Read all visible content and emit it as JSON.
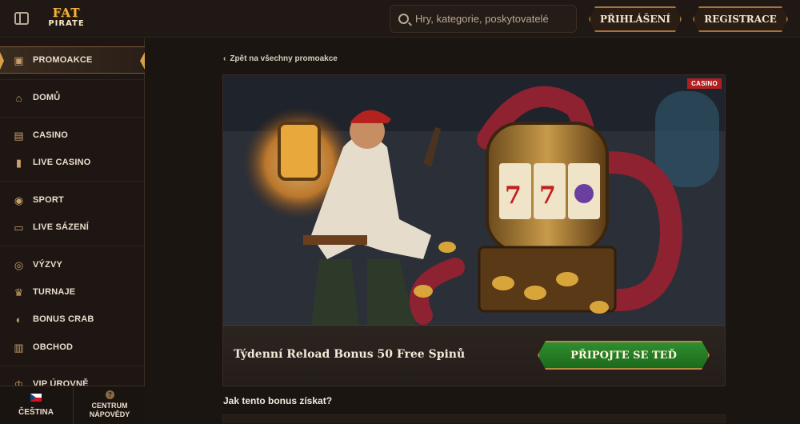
{
  "header": {
    "logo_top": "FAT",
    "logo_bottom": "PIRATE",
    "search_placeholder": "Hry, kategorie, poskytovatelé",
    "login_label": "PŘIHLÁŠENÍ",
    "register_label": "REGISTRACE"
  },
  "sidebar": {
    "items": [
      {
        "label": "PROMOAKCE",
        "icon": "gift-icon",
        "glyph": "▣",
        "active": true
      },
      {
        "label": "DOMŮ",
        "icon": "home-icon",
        "glyph": "⌂"
      },
      {
        "label": "CASINO",
        "icon": "slot-machine-icon",
        "glyph": "▤"
      },
      {
        "label": "LIVE CASINO",
        "icon": "cards-icon",
        "glyph": "▮"
      },
      {
        "label": "SPORT",
        "icon": "ball-icon",
        "glyph": "◉"
      },
      {
        "label": "LIVE SÁZENÍ",
        "icon": "live-icon",
        "glyph": "▭"
      },
      {
        "label": "VÝZVY",
        "icon": "medal-icon",
        "glyph": "◎"
      },
      {
        "label": "TURNAJE",
        "icon": "trophy-icon",
        "glyph": "♛"
      },
      {
        "label": "BONUS CRAB",
        "icon": "crab-icon",
        "glyph": "◐"
      },
      {
        "label": "OBCHOD",
        "icon": "bag-icon",
        "glyph": "▥"
      },
      {
        "label": "VIP ÚROVNĚ",
        "icon": "crown-icon",
        "glyph": "♔"
      }
    ],
    "footer": {
      "language": "ČEŠTINA",
      "help_line1": "CENTRUM",
      "help_line2": "NÁPOVĚDY"
    }
  },
  "main": {
    "back_link": "Zpět na všechny promoakce",
    "badge": "CASINO",
    "promo_title": "Týdenní Reload Bonus 50 Free Spinů",
    "join_button": "PŘIPOJTE SE TEĎ",
    "how_title": "Jak tento bonus získat?"
  },
  "colors": {
    "background": "#1b1512",
    "accent_gold": "#d9a04b",
    "join_green": "#2f8e2f",
    "badge_red": "#b21f1f"
  }
}
